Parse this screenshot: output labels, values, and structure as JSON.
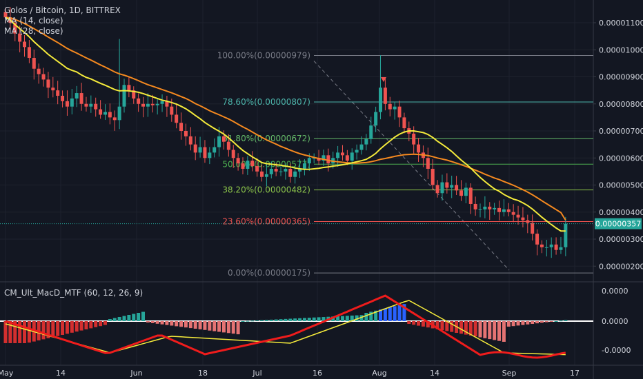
{
  "header": {
    "title": "Golos / Bitcoin, 1D, BITTREX",
    "ma14": "MA (14, close)",
    "ma28": "MA (28, close)"
  },
  "indicator": {
    "title": "CM_Ult_MacD_MTF (60, 12, 26, 9)"
  },
  "colors": {
    "background": "#131722",
    "up": "#26a69a",
    "down": "#ef5350",
    "ma14": "#f5eb3b",
    "ma28": "#f5891f",
    "fib_100": "#787b86",
    "fib_786": "#4db6ac",
    "fib_618": "#66bb6a",
    "fib_50": "#4caf50",
    "fib_382": "#8bc34a",
    "fib_236": "#ef5350",
    "fib_0": "#787b86",
    "price_tag": "#26a69a"
  },
  "price_axis": {
    "ticks": [
      "0.00001100",
      "0.00001000",
      "0.00000900",
      "0.00000800",
      "0.00000700",
      "0.00000600",
      "0.00000500",
      "0.00000400",
      "0.00000300",
      "0.00000200"
    ],
    "last_price": "0.00000357"
  },
  "macd_axis": {
    "ticks": [
      "0.0000",
      "0.0000",
      "-0.0000"
    ]
  },
  "time_axis": {
    "ticks": [
      "May",
      "14",
      "Jun",
      "18",
      "Jul",
      "16",
      "Aug",
      "14",
      "Sep",
      "17"
    ]
  },
  "fib_levels": [
    {
      "label": "100.00%(0.00000979)",
      "price": 9.79e-06
    },
    {
      "label": "78.60%(0.00000807)",
      "price": 8.07e-06
    },
    {
      "label": "61.80%(0.00000672)",
      "price": 6.72e-06
    },
    {
      "label": "50.00%(0.00000577)",
      "price": 5.77e-06
    },
    {
      "label": "38.20%(0.00000482)",
      "price": 4.82e-06
    },
    {
      "label": "23.60%(0.00000365)",
      "price": 3.65e-06
    },
    {
      "label": "0.00%(0.00000175)",
      "price": 1.75e-06
    }
  ],
  "chart_data": {
    "type": "candlestick",
    "title": "Golos / Bitcoin, 1D, BITTREX",
    "price_unit": "BTC",
    "ylim": [
      1.5e-06,
      1.18e-05
    ],
    "x_ticks": [
      "May",
      "14",
      "Jun",
      "18",
      "Jul",
      "16",
      "Aug",
      "14",
      "Sep",
      "17"
    ],
    "closes": [
      11.2,
      11.0,
      10.6,
      10.3,
      10.1,
      9.7,
      9.3,
      9.1,
      8.9,
      8.6,
      8.5,
      8.3,
      8.1,
      7.9,
      8.2,
      8.4,
      8.0,
      7.9,
      8.0,
      7.8,
      7.6,
      7.7,
      7.5,
      7.4,
      7.9,
      8.7,
      8.5,
      8.2,
      8.0,
      7.9,
      8.0,
      7.95,
      8.0,
      8.1,
      7.9,
      7.6,
      7.3,
      7.0,
      6.8,
      6.5,
      6.2,
      6.4,
      6.0,
      6.2,
      6.4,
      6.8,
      6.6,
      6.3,
      6.0,
      5.8,
      5.6,
      5.9,
      5.7,
      5.5,
      5.3,
      5.4,
      5.6,
      5.5,
      5.5,
      5.6,
      5.3,
      5.5,
      5.6,
      5.8,
      6.0,
      6.0,
      5.9,
      6.1,
      5.8,
      6.0,
      6.2,
      6.1,
      5.9,
      6.2,
      6.3,
      6.5,
      6.7,
      7.2,
      7.7,
      8.6,
      8.0,
      7.8,
      7.9,
      7.5,
      7.1,
      6.9,
      6.5,
      6.2,
      6.0,
      5.6,
      5.0,
      4.7,
      5.1,
      4.9,
      5.0,
      4.8,
      4.6,
      4.9,
      4.3,
      4.1,
      4.1,
      4.2,
      4.1,
      4.15,
      4.0,
      4.1,
      4.0,
      3.9,
      3.8,
      3.7,
      3.6,
      3.2,
      2.8,
      2.7,
      2.7,
      2.8,
      2.6,
      2.7,
      3.57
    ],
    "series": [
      {
        "name": "MA (14, close)",
        "values": [
          11.2,
          11.1,
          10.93,
          10.78,
          10.64,
          10.48,
          10.3,
          10.14,
          9.99,
          9.83,
          9.7,
          9.57,
          9.44,
          9.31,
          9.24,
          9.18,
          9.07,
          8.98,
          8.92,
          8.84,
          8.76,
          8.69,
          8.61,
          8.53,
          8.48,
          8.49,
          8.48,
          8.46,
          8.43,
          8.38,
          8.32,
          8.26,
          8.2,
          8.14,
          8.1,
          8.05,
          7.99,
          7.91,
          7.82,
          7.7,
          7.57,
          7.45,
          7.31,
          7.2,
          7.09,
          6.99,
          6.88,
          6.74,
          6.59,
          6.43,
          6.28,
          6.16,
          6.04,
          5.94,
          5.83,
          5.79,
          5.77,
          5.75,
          5.73,
          5.7,
          5.67,
          5.63,
          5.6,
          5.58,
          5.58,
          5.6,
          5.62,
          5.65,
          5.67,
          5.7,
          5.72,
          5.75,
          5.78,
          5.82,
          5.86,
          5.9,
          5.95,
          6.05,
          6.17,
          6.34,
          6.49,
          6.63,
          6.77,
          6.88,
          6.96,
          7.0,
          7.0,
          6.97,
          6.94,
          6.87,
          6.76,
          6.62,
          6.5,
          6.38,
          6.24,
          6.08,
          5.92,
          5.78,
          5.63,
          5.45,
          5.28,
          5.13,
          4.99,
          4.86,
          4.77,
          4.65,
          4.56,
          4.48,
          4.43,
          4.34,
          4.24,
          4.11,
          3.96,
          3.81,
          3.67,
          3.54,
          3.41,
          3.3,
          3.3
        ]
      },
      {
        "name": "MA (28, close)",
        "values": [
          11.2,
          11.18,
          11.12,
          11.05,
          10.97,
          10.88,
          10.78,
          10.68,
          10.58,
          10.47,
          10.37,
          10.27,
          10.16,
          10.05,
          9.96,
          9.88,
          9.79,
          9.7,
          9.62,
          9.53,
          9.44,
          9.36,
          9.27,
          9.18,
          9.11,
          9.06,
          9.0,
          8.93,
          8.86,
          8.78,
          8.71,
          8.65,
          8.59,
          8.53,
          8.47,
          8.41,
          8.34,
          8.27,
          8.2,
          8.11,
          8.01,
          7.93,
          7.84,
          7.75,
          7.67,
          7.6,
          7.52,
          7.44,
          7.35,
          7.25,
          7.15,
          7.06,
          6.96,
          6.86,
          6.76,
          6.67,
          6.59,
          6.51,
          6.43,
          6.36,
          6.29,
          6.22,
          6.16,
          6.11,
          6.07,
          6.02,
          5.98,
          5.95,
          5.91,
          5.88,
          5.86,
          5.84,
          5.82,
          5.81,
          5.81,
          5.82,
          5.83,
          5.86,
          5.9,
          5.95,
          5.98,
          6.02,
          6.06,
          6.09,
          6.12,
          6.13,
          6.14,
          6.13,
          6.11,
          6.09,
          6.05,
          6.0,
          5.96,
          5.92,
          5.87,
          5.81,
          5.75,
          5.69,
          5.62,
          5.55,
          5.48,
          5.4,
          5.33,
          5.26,
          5.2,
          5.13,
          5.06,
          4.99,
          4.91,
          4.83,
          4.74,
          4.64,
          4.53,
          4.42,
          4.31,
          4.2,
          4.09,
          3.98,
          3.7
        ]
      }
    ],
    "fibonacci": [
      {
        "level": "100.00%",
        "price": 9.79e-06
      },
      {
        "level": "78.60%",
        "price": 8.07e-06
      },
      {
        "level": "61.80%",
        "price": 6.72e-06
      },
      {
        "level": "50.00%",
        "price": 5.77e-06
      },
      {
        "level": "38.20%",
        "price": 4.82e-06
      },
      {
        "level": "23.60%",
        "price": 3.65e-06
      },
      {
        "level": "0.00%",
        "price": 1.75e-06
      }
    ],
    "last_price": 3.57e-06
  }
}
